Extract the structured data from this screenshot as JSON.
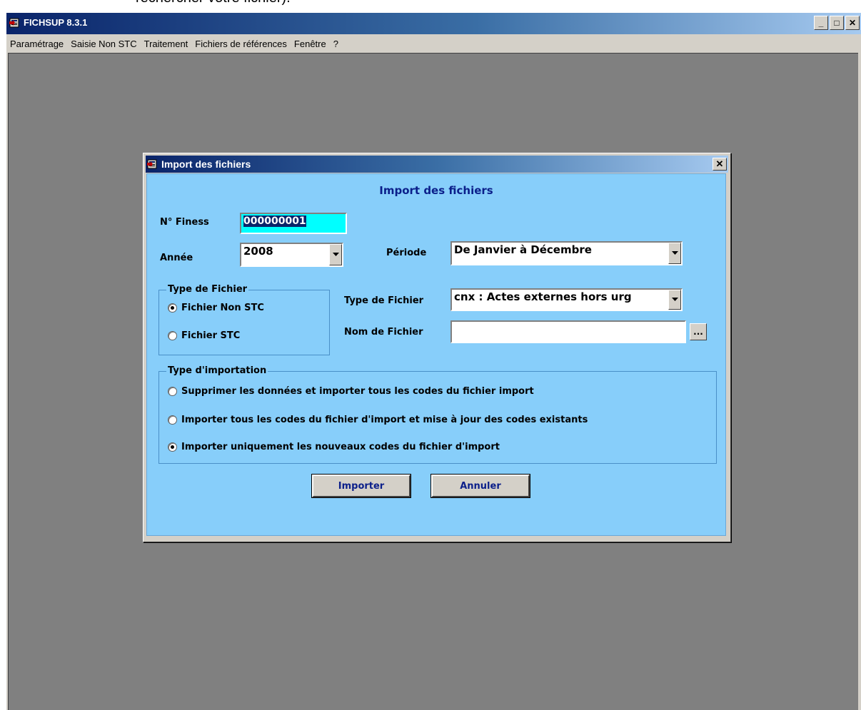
{
  "doc_snippet": "rechercher votre fichier).",
  "app": {
    "title": "FICHSUP 8.3.1",
    "window_controls": {
      "minimize": "_",
      "maximize": "□",
      "close": "✕"
    }
  },
  "menu": [
    "Paramétrage",
    "Saisie Non STC",
    "Traitement",
    "Fichiers de références",
    "Fenêtre",
    "?"
  ],
  "dialog": {
    "title": "Import des fichiers",
    "heading": "Import des fichiers",
    "close": "✕",
    "finess": {
      "label": "N° Finess",
      "value": "000000001"
    },
    "annee": {
      "label": "Année",
      "value": "2008"
    },
    "periode": {
      "label": "Période",
      "value": "De Janvier à Décembre"
    },
    "type_fichier_group": {
      "legend": "Type de Fichier",
      "options": [
        "Fichier Non STC",
        "Fichier STC"
      ],
      "selected": 0
    },
    "type_fichier": {
      "label": "Type de Fichier",
      "value": "cnx : Actes externes hors urg"
    },
    "nom_fichier": {
      "label": "Nom de Fichier",
      "value": "",
      "browse": "..."
    },
    "type_importation": {
      "legend": "Type d'importation",
      "options": [
        "Supprimer les données et importer tous les codes du fichier import",
        "Importer tous les codes du fichier d'import et mise à jour des codes existants",
        "Importer uniquement les nouveaux codes du fichier d'import"
      ],
      "selected": 2
    },
    "buttons": {
      "import": "Importer",
      "cancel": "Annuler"
    }
  },
  "colors": {
    "dialog_body": "#87cefa",
    "heading": "#0b1f8a",
    "finess_bg": "#00ffff",
    "mdi_bg": "#808080"
  }
}
